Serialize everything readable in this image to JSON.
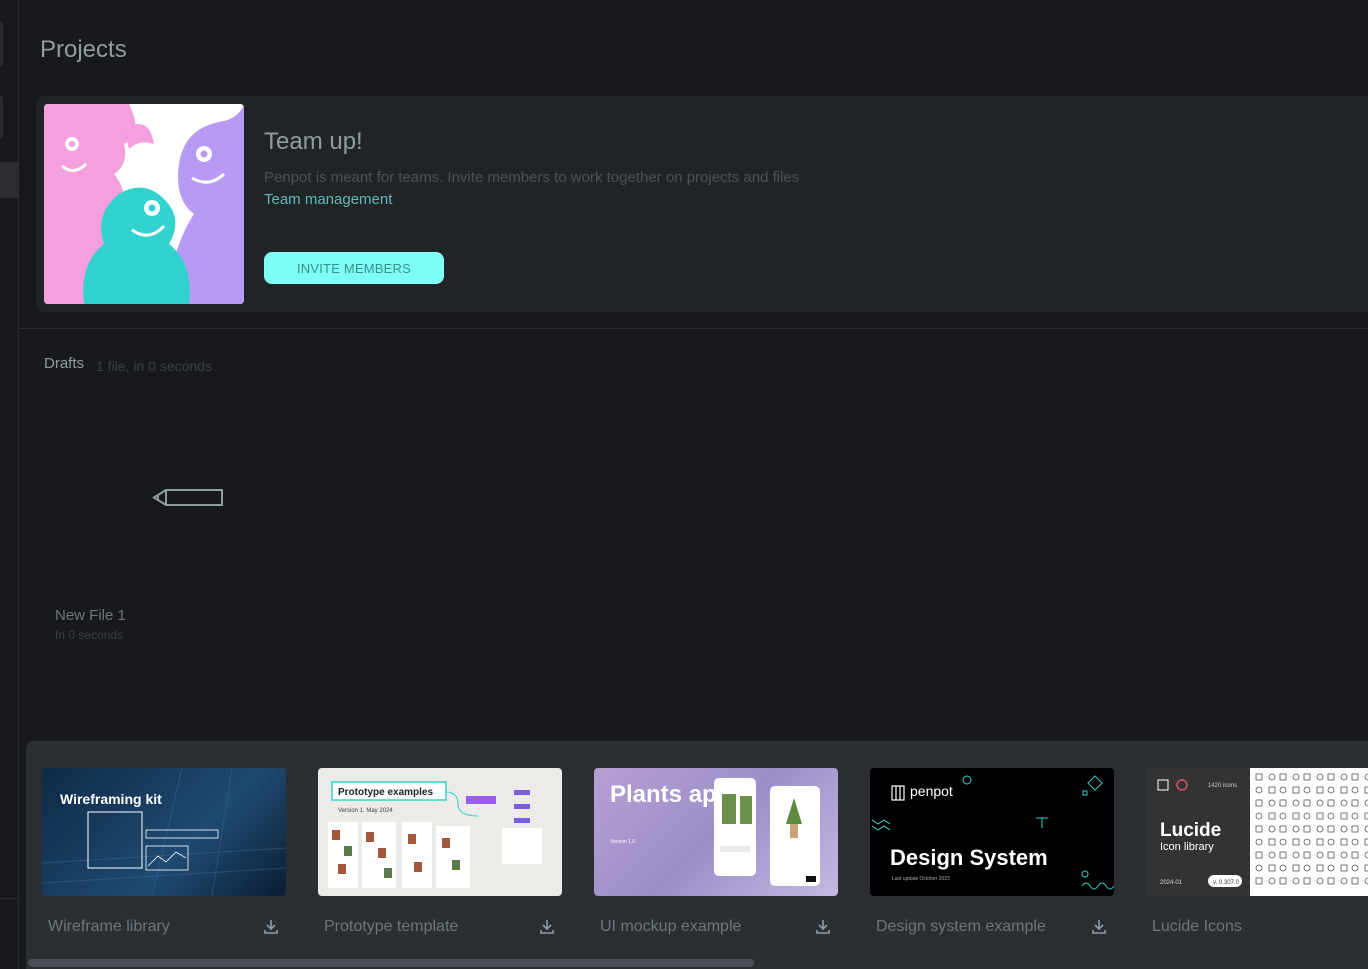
{
  "page": {
    "title": "Projects"
  },
  "banner": {
    "title": "Team up!",
    "description": "Penpot is meant for teams. Invite members to work together on projects and files",
    "link": "Team management",
    "invite_button": "INVITE MEMBERS"
  },
  "drafts": {
    "title": "Drafts",
    "meta": "1 file, in 0 seconds",
    "files": [
      {
        "name": "New File 1",
        "date": "In 0 seconds"
      }
    ]
  },
  "templates": [
    {
      "label": "Wireframe library",
      "thumb_title": "Wireframing kit"
    },
    {
      "label": "Prototype template",
      "thumb_title": "Prototype examples",
      "thumb_sub": "Version 1. May 2024"
    },
    {
      "label": "UI mockup example",
      "thumb_title": "Plants app",
      "thumb_sub": "Version 1.0"
    },
    {
      "label": "Design system example",
      "thumb_title": "Design System",
      "thumb_brand": "penpot",
      "thumb_sub": "Last update October 2023"
    },
    {
      "label": "Lucide Icons",
      "thumb_title": "Lucide",
      "thumb_sub": "Icon library",
      "thumb_count": "1420 icons",
      "thumb_date": "2024-01",
      "thumb_version": "v. 0.307.0"
    }
  ],
  "colors": {
    "accent": "#7efff5",
    "link": "#5fb9b3",
    "bg": "#18191c",
    "panel": "#212426"
  }
}
